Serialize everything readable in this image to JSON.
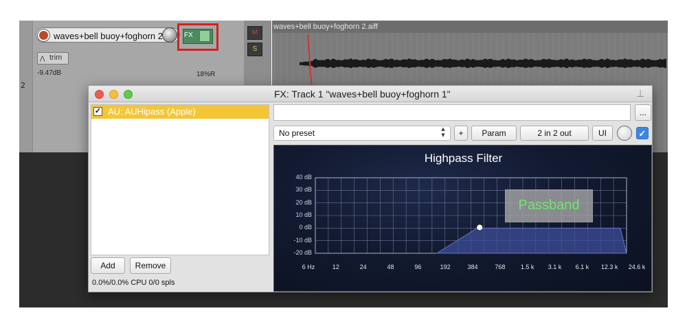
{
  "track": {
    "name": "waves+bell buoy+foghorn 2",
    "fx_button": "FX",
    "trim_label": "trim",
    "volume_readout": "-9.47dB",
    "pan_readout": "18%R",
    "track_number": "2",
    "mute_label": "M",
    "solo_label": "S"
  },
  "arrange": {
    "item_title": "waves+bell buoy+foghorn 2.aiff"
  },
  "fx_window": {
    "title": "FX: Track 1 \"waves+bell buoy+foghorn 1\"",
    "plugins": [
      {
        "label": "AU: AUHipass (Apple)",
        "enabled": true,
        "selected": true
      }
    ],
    "add_label": "Add",
    "remove_label": "Remove",
    "cpu_readout": "0.0%/0.0% CPU 0/0 spls",
    "param_field_value": "",
    "more_label": "...",
    "preset_value": "No preset",
    "plus_label": "+",
    "param_label": "Param",
    "io_label": "2 in 2 out",
    "ui_label": "UI",
    "ui_checked": true
  },
  "plugin_ui": {
    "title": "Highpass Filter",
    "overlay_label": "Passband",
    "db_ticks": [
      "40 dB",
      "30 dB",
      "20 dB",
      "10 dB",
      "0 dB",
      "-10 dB",
      "-20 dB"
    ],
    "hz_ticks": [
      "6 Hz",
      "12",
      "24",
      "48",
      "96",
      "192",
      "384",
      "768",
      "1.5 k",
      "3.1 k",
      "6.1 k",
      "12.3 k",
      "24.6 k"
    ],
    "colors": {
      "background": "#121a30",
      "grid": "#6b7596",
      "curve_fill": "#3e4d98",
      "passband_text": "#6fe86a"
    }
  },
  "colors": {
    "selection": "#f4c636",
    "fx_active": "#4d8a5e",
    "highlight_box": "#d42020"
  }
}
